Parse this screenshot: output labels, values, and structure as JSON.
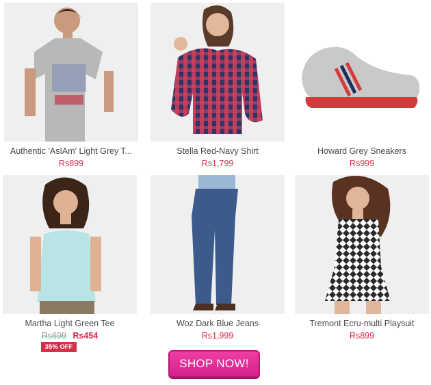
{
  "products": [
    {
      "title": "Authentic 'AsIAm' Light Grey T...",
      "price": "Rs899"
    },
    {
      "title": "Stella Red-Navy Shirt",
      "price": "Rs1,799"
    },
    {
      "title": "Howard Grey Sneakers",
      "price": "Rs999"
    },
    {
      "title": "Martha Light Green Tee",
      "price_old": "Rs699",
      "price_new": "Rs454",
      "badge": "35% OFF"
    },
    {
      "title": "Woz Dark Blue Jeans",
      "price": "Rs1,999"
    },
    {
      "title": "Tremont Ecru-multi Playsuit",
      "price": "Rs899"
    }
  ],
  "cta": {
    "label": "SHOP NOW!"
  },
  "colors": {
    "price": "#e0294a",
    "badge": "#d9304a",
    "button": "#e22f9b"
  }
}
